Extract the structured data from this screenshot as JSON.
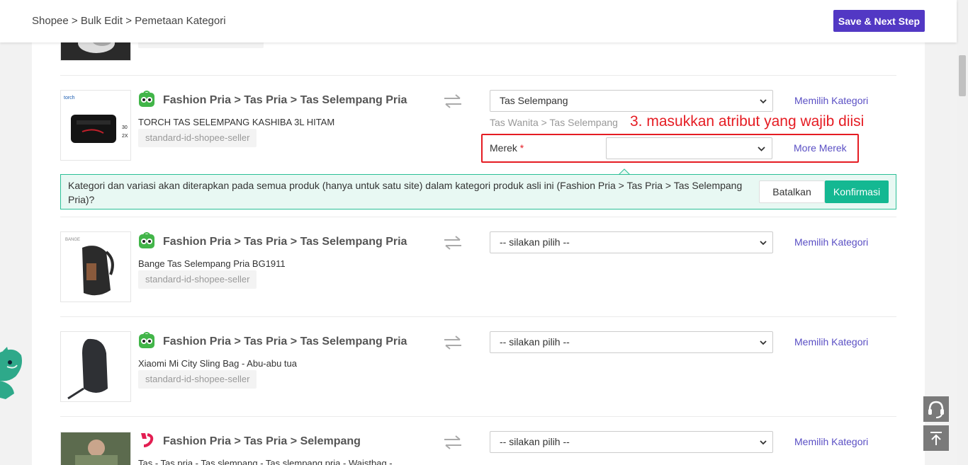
{
  "header": {
    "breadcrumb": [
      "Shopee",
      ">",
      "Bulk Edit",
      ">",
      "Pemetaan Kategori"
    ],
    "save_label": "Save & Next Step"
  },
  "rows": [
    {
      "category_path": "Fashion Pria > Tas Pria > Tas Selempang Pria",
      "product_name": "TORCH TAS SELEMPANG KASHIBA 3L HITAM",
      "shop_tag": "standard-id-shopee-seller",
      "selected_category": "Tas Selempang",
      "pick_label": "Memilih Kategori",
      "sub_path": "Tas Wanita > Tas Selempang",
      "attribute_label": "Merek",
      "attribute_required": "*",
      "attribute_value": "",
      "more_label": "More Merek"
    },
    {
      "category_path": "Fashion Pria > Tas Pria > Tas Selempang Pria",
      "product_name": "Bange Tas Selempang Pria BG1911",
      "shop_tag": "standard-id-shopee-seller",
      "selected_category": "-- silakan pilih --",
      "pick_label": "Memilih Kategori"
    },
    {
      "category_path": "Fashion Pria > Tas Pria > Tas Selempang Pria",
      "product_name": "Xiaomi Mi City Sling Bag - Abu-abu tua",
      "shop_tag": "standard-id-shopee-seller",
      "selected_category": "-- silakan pilih --",
      "pick_label": "Memilih Kategori"
    },
    {
      "category_path": "Fashion Pria > Tas Pria > Selempang",
      "product_name": "Tas - Tas pria - Tas slempang - Tas slempang pria - Waistbag -",
      "selected_category": "-- silakan pilih --",
      "pick_label": "Memilih Kategori"
    }
  ],
  "annotation": "3. masukkan atribut yang wajib diisi",
  "notice": {
    "text": "Kategori dan variasi akan diterapkan pada semua produk (hanya untuk satu site) dalam kategori produk asli ini (Fashion Pria > Tas Pria > Tas Selempang Pria)?",
    "cancel_label": "Batalkan",
    "confirm_label": "Konfirmasi"
  },
  "colors": {
    "accent": "#5238c4",
    "link": "#5a4fc4",
    "confirm": "#14b892",
    "annotation_red": "#e51c23"
  },
  "icons": {
    "shop_green": "tokopedia-owl-icon",
    "shop_red": "bukalapak-icon",
    "swap": "swap-arrows-icon",
    "support": "headset-icon",
    "top": "back-to-top-icon"
  }
}
